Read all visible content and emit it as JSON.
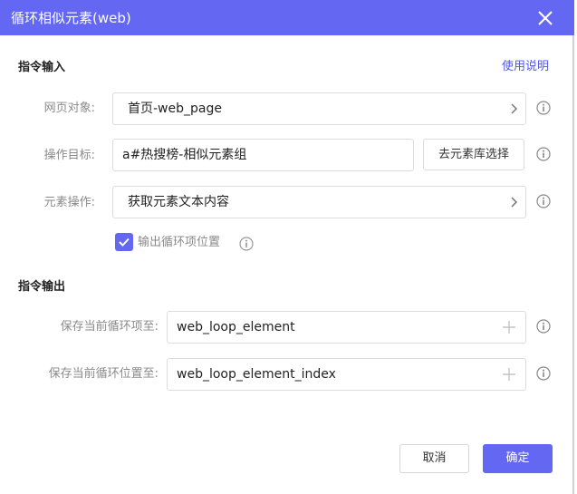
{
  "dialog": {
    "title": "循环相似元素(web)",
    "close_icon": "close-icon"
  },
  "input_section": {
    "title": "指令输入",
    "help_link": "使用说明",
    "web_object": {
      "label": "网页对象:",
      "value": "首页-web_page",
      "icon": "chevron-right-icon"
    },
    "target": {
      "label": "操作目标:",
      "value": "a#热搜榜-相似元素组",
      "library_button": "去元素库选择"
    },
    "element_action": {
      "label": "元素操作:",
      "value": "获取元素文本内容",
      "icon": "chevron-right-icon"
    },
    "output_position": {
      "label": "输出循环项位置",
      "checked": true
    }
  },
  "output_section": {
    "title": "指令输出",
    "save_item": {
      "label": "保存当前循环项至:",
      "value": "web_loop_element"
    },
    "save_index": {
      "label": "保存当前循环位置至:",
      "value": "web_loop_element_index"
    }
  },
  "footer": {
    "cancel": "取消",
    "confirm": "确定"
  },
  "colors": {
    "accent": "#6467f2",
    "link": "#4f56e8",
    "label": "#8a8a8a",
    "border": "#dcdcdc"
  }
}
